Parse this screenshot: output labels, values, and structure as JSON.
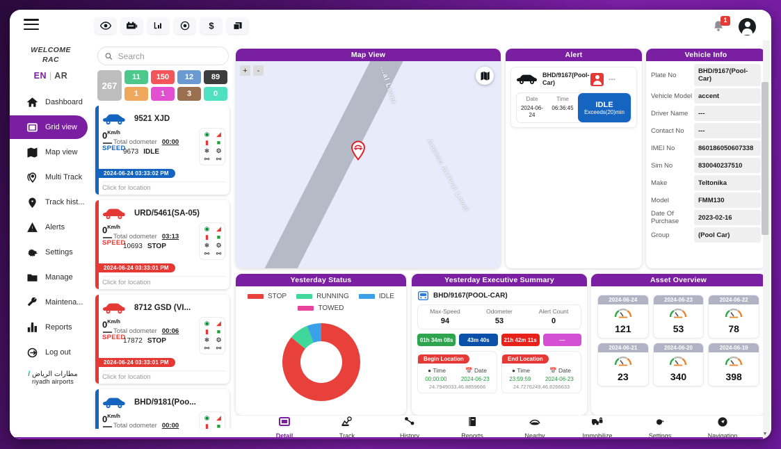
{
  "app": {
    "welcome_line1": "WELCOME",
    "welcome_line2": "RAC",
    "lang_en": "EN",
    "lang_sep": "|",
    "lang_ar": "AR",
    "logo_ar": "مطارات الرياض",
    "logo_en": "riyadh airports",
    "notification_count": "1"
  },
  "toolbar": {
    "icons": [
      {
        "name": "eye-icon",
        "glyph": "eye"
      },
      {
        "name": "battery-icon",
        "glyph": "battery"
      },
      {
        "name": "chart-icon",
        "glyph": "chart"
      },
      {
        "name": "target-icon",
        "glyph": "target"
      },
      {
        "name": "dollar-icon",
        "glyph": "dollar"
      },
      {
        "name": "layers-icon",
        "glyph": "layers"
      }
    ]
  },
  "sidebar": {
    "items": [
      {
        "label": "Dashboard",
        "icon": "home-icon",
        "active": false
      },
      {
        "label": "Grid view",
        "icon": "grid-icon",
        "active": true
      },
      {
        "label": "Map view",
        "icon": "map-icon",
        "active": false
      },
      {
        "label": "Multi Track",
        "icon": "multi-track-icon",
        "active": false
      },
      {
        "label": "Track hist...",
        "icon": "pin-icon",
        "active": false
      },
      {
        "label": "Alerts",
        "icon": "warning-icon",
        "active": false
      },
      {
        "label": "Settings",
        "icon": "gear-icon",
        "active": false
      },
      {
        "label": "Manage",
        "icon": "folder-icon",
        "active": false
      },
      {
        "label": "Maintena...",
        "icon": "wrench-icon",
        "active": false
      },
      {
        "label": "Reports",
        "icon": "bar-chart-icon",
        "active": false
      },
      {
        "label": "Log out",
        "icon": "logout-icon",
        "active": false
      }
    ]
  },
  "search": {
    "placeholder": "Search",
    "value": ""
  },
  "counts": {
    "total": "267",
    "badges": [
      {
        "value": "11",
        "color": "#4cc98a"
      },
      {
        "value": "150",
        "color": "#f2565b"
      },
      {
        "value": "12",
        "color": "#6a9ad0"
      },
      {
        "value": "89",
        "color": "#3c3c3c"
      },
      {
        "value": "1",
        "color": "#efa85c"
      },
      {
        "value": "1",
        "color": "#e24fd0"
      },
      {
        "value": "3",
        "color": "#9b7050"
      },
      {
        "value": "0",
        "color": "#4fe0c0"
      }
    ]
  },
  "vehicles": [
    {
      "name": "9521 XJD",
      "accent": "#1565c0",
      "speed": "0",
      "speed_unit": "Km/h",
      "speed_label": "SPEED",
      "odometer_label": "Total odometer",
      "duration": "00:00",
      "odometer": "9673",
      "status": "IDLE",
      "timestamp": "2024-06-24 03:33:02 PM",
      "location_hint": "Click for location"
    },
    {
      "name": "URD/5461(SA-05)",
      "accent": "#e53935",
      "speed": "0",
      "speed_unit": "Km/h",
      "speed_label": "SPEED",
      "odometer_label": "Total odometer",
      "duration": "03:13",
      "odometer": "10693",
      "status": "STOP",
      "timestamp": "2024-06-24 03:33:01 PM",
      "location_hint": "Click for location"
    },
    {
      "name": "8712 GSD (VI...",
      "accent": "#e53935",
      "speed": "0",
      "speed_unit": "Km/h",
      "speed_label": "SPEED",
      "odometer_label": "Total odometer",
      "duration": "00:06",
      "odometer": "17872",
      "status": "STOP",
      "timestamp": "2024-06-24 03:33:01 PM",
      "location_hint": "Click for location"
    },
    {
      "name": "BHD/9181(Poo...",
      "accent": "#1565c0",
      "speed": "0",
      "speed_unit": "Km/h",
      "speed_label": "SPEED",
      "odometer_label": "Total odometer",
      "duration": "00:00",
      "odometer": "",
      "status": "",
      "timestamp": "",
      "location_hint": ""
    }
  ],
  "map": {
    "title": "Map View",
    "zoom_in": "+",
    "zoom_out": "-",
    "road_label_1": "Access Arrival Level",
    "road_label_2": "...al Level"
  },
  "alert": {
    "title": "Alert",
    "vehicle": "BHD/9167(Pool-Car)",
    "driver": "---",
    "date_label": "Date",
    "time_label": "Time",
    "date_value": "2024-06-24",
    "time_value": "06:36:45",
    "badge_title": "IDLE",
    "badge_sub": "Exceeds(20)min"
  },
  "vehicle_info": {
    "title": "Vehicle Info",
    "rows": [
      {
        "key": "Plate No",
        "value": "BHD/9167(Pool-Car)"
      },
      {
        "key": "Vehicle Model",
        "value": "accent"
      },
      {
        "key": "Driver Name",
        "value": "---"
      },
      {
        "key": "Contact No",
        "value": "---"
      },
      {
        "key": "IMEI No",
        "value": "860186050607338"
      },
      {
        "key": "Sim No",
        "value": "830040237510"
      },
      {
        "key": "Make",
        "value": "Teltonika"
      },
      {
        "key": "Model",
        "value": "FMM130"
      },
      {
        "key": "Date Of Purchase",
        "value": "2023-02-16"
      },
      {
        "key": "Group",
        "value": "(Pool Car)"
      }
    ]
  },
  "chart_data": {
    "type": "pie",
    "title": "Yesterday Status",
    "categories": [
      "STOP",
      "RUNNING",
      "IDLE",
      "TOWED"
    ],
    "values": [
      86,
      8,
      6,
      0
    ],
    "colors": [
      "#e8403a",
      "#3fd89a",
      "#3aa0e8",
      "#e8449c"
    ],
    "legend_position": "top",
    "donut": true
  },
  "exec": {
    "title": "Yesterday Executive Summary",
    "vehicle": "BHD/9167(POOL-CAR)",
    "stats": [
      {
        "label": "Max-Speed",
        "value": "94"
      },
      {
        "label": "Odometer",
        "value": "53"
      },
      {
        "label": "Alert Count",
        "value": "0"
      }
    ],
    "durations": [
      {
        "value": "01h 34m 08s",
        "color": "#2ea44f"
      },
      {
        "value": "43m 40s",
        "color": "#0a4fa8"
      },
      {
        "value": "21h 42m 11s",
        "color": "#e8211b"
      },
      {
        "value": "—",
        "color": "#d44fd4"
      }
    ],
    "begin": {
      "tag": "Begin Location",
      "time_label": "Time",
      "date_label": "Date",
      "time": "00:00:00",
      "date": "2024-06-23",
      "coords": "24.7949033,46.8859666"
    },
    "end": {
      "tag": "End Location",
      "time_label": "Time",
      "date_label": "Date",
      "time": "23:59:59",
      "date": "2024-06-23",
      "coords": "24.7276249,46.8266633"
    }
  },
  "asset": {
    "title": "Asset Overview",
    "cards": [
      {
        "date": "2024-06-24",
        "value": "121"
      },
      {
        "date": "2024-06-23",
        "value": "53"
      },
      {
        "date": "2024-06-22",
        "value": "78"
      },
      {
        "date": "2024-06-21",
        "value": "23"
      },
      {
        "date": "2024-06-20",
        "value": "340"
      },
      {
        "date": "2024-06-19",
        "value": "398"
      }
    ]
  },
  "bottom_nav": {
    "items": [
      {
        "label": "Detail",
        "icon": "detail-icon",
        "active": true
      },
      {
        "label": "Track",
        "icon": "track-icon",
        "active": false
      },
      {
        "label": "History",
        "icon": "history-icon",
        "active": false
      },
      {
        "label": "Reports",
        "icon": "reports-icon",
        "active": false
      },
      {
        "label": "Nearby",
        "icon": "nearby-icon",
        "active": false
      },
      {
        "label": "Immobilize",
        "icon": "immobilize-icon",
        "active": false
      },
      {
        "label": "Settings",
        "icon": "settings-icon",
        "active": false
      },
      {
        "label": "Navigation",
        "icon": "navigation-icon",
        "active": false
      }
    ]
  }
}
